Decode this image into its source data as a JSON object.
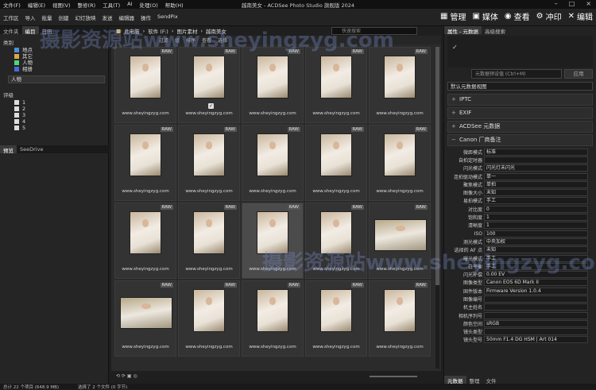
{
  "titlebar": {
    "menus": [
      "文件(F)",
      "编辑(E)",
      "视图(V)",
      "整修(R)",
      "工具(T)",
      "AI",
      "处理(O)",
      "帮助(H)"
    ],
    "title": "越南美女 - ACDSee Photo Studio 旗舰版 2024"
  },
  "toolbar": {
    "tools": [
      "工作区",
      "导入",
      "批量",
      "创建",
      "幻灯放映",
      "发送",
      "编辑器",
      "操作",
      "SendPix"
    ],
    "modes": [
      "管理",
      "媒体",
      "查看",
      "冲印",
      "编辑"
    ]
  },
  "left": {
    "tabs": [
      "文件夹",
      "编目",
      "日历"
    ],
    "cat_header": "类别",
    "cat_items": [
      "地点",
      "其它",
      "人物",
      "相册"
    ],
    "people": "人物",
    "rating_header": "评级",
    "ratings": [
      "1",
      "2",
      "3",
      "4",
      "5"
    ],
    "tabs2": [
      "预览",
      "SeeDrive"
    ]
  },
  "center": {
    "path": [
      "此电脑",
      "软件 (F:)",
      "图片素材",
      "越南美女"
    ],
    "search_placeholder": "快速搜索",
    "subbar": [
      "过滤",
      "组",
      "排序",
      "查看",
      "选择"
    ],
    "caption": "www.sheyingzyg.com",
    "raw": "RAW"
  },
  "right": {
    "tabs": [
      "属性 - 元数据",
      "高级搜索"
    ],
    "preset": "元数据预设值 (Ctrl+M)",
    "apply": "应用",
    "view_select": "默认元数据视图",
    "bands": [
      "IPTC",
      "EXIF",
      "ACDSee 元数据",
      "Canon 厂商备注"
    ],
    "rows": [
      {
        "k": "微距模式",
        "v": "标准"
      },
      {
        "k": "自拍定时器",
        "v": ""
      },
      {
        "k": "闪光模式",
        "v": "闪光灯未闪光"
      },
      {
        "k": "连拍驱动模式",
        "v": "单一"
      },
      {
        "k": "聚焦模式",
        "v": "单拍"
      },
      {
        "k": "图像大小",
        "v": "未知"
      },
      {
        "k": "易拍模式",
        "v": "手工"
      },
      {
        "k": "对比度",
        "v": "0"
      },
      {
        "k": "饱和度",
        "v": "1"
      },
      {
        "k": "清晰度",
        "v": "1"
      },
      {
        "k": "ISO",
        "v": "100"
      },
      {
        "k": "测光模式",
        "v": "中央加权"
      },
      {
        "k": "选择的 AF 点",
        "v": "未知"
      },
      {
        "k": "曝光模式",
        "v": "手工"
      },
      {
        "k": "白平衡",
        "v": "手工"
      },
      {
        "k": "闪光补偿",
        "v": "0.00 EV"
      },
      {
        "k": "图像类型",
        "v": "Canon EOS 6D Mark II"
      },
      {
        "k": "固件版本",
        "v": "Firmware Version 1.0.4"
      },
      {
        "k": "图像编号",
        "v": ""
      },
      {
        "k": "机主姓名",
        "v": ""
      },
      {
        "k": "相机序列号",
        "v": ""
      },
      {
        "k": "颜色空间",
        "v": "sRGB"
      },
      {
        "k": "镜头类型",
        "v": ""
      },
      {
        "k": "镜头型号",
        "v": "50mm F1.4 DG HSM | Art 014"
      }
    ],
    "bottom_tabs": [
      "元数据",
      "整理",
      "文件"
    ]
  },
  "status": {
    "total": "总计 22 个项目 (648.9 MB)",
    "selected": "选择了 2 个文件 (0 字节)"
  },
  "watermarks": [
    "摄影资源站www.sheyingzyg.com",
    "摄影资源站www.sheyingzyg.com"
  ]
}
